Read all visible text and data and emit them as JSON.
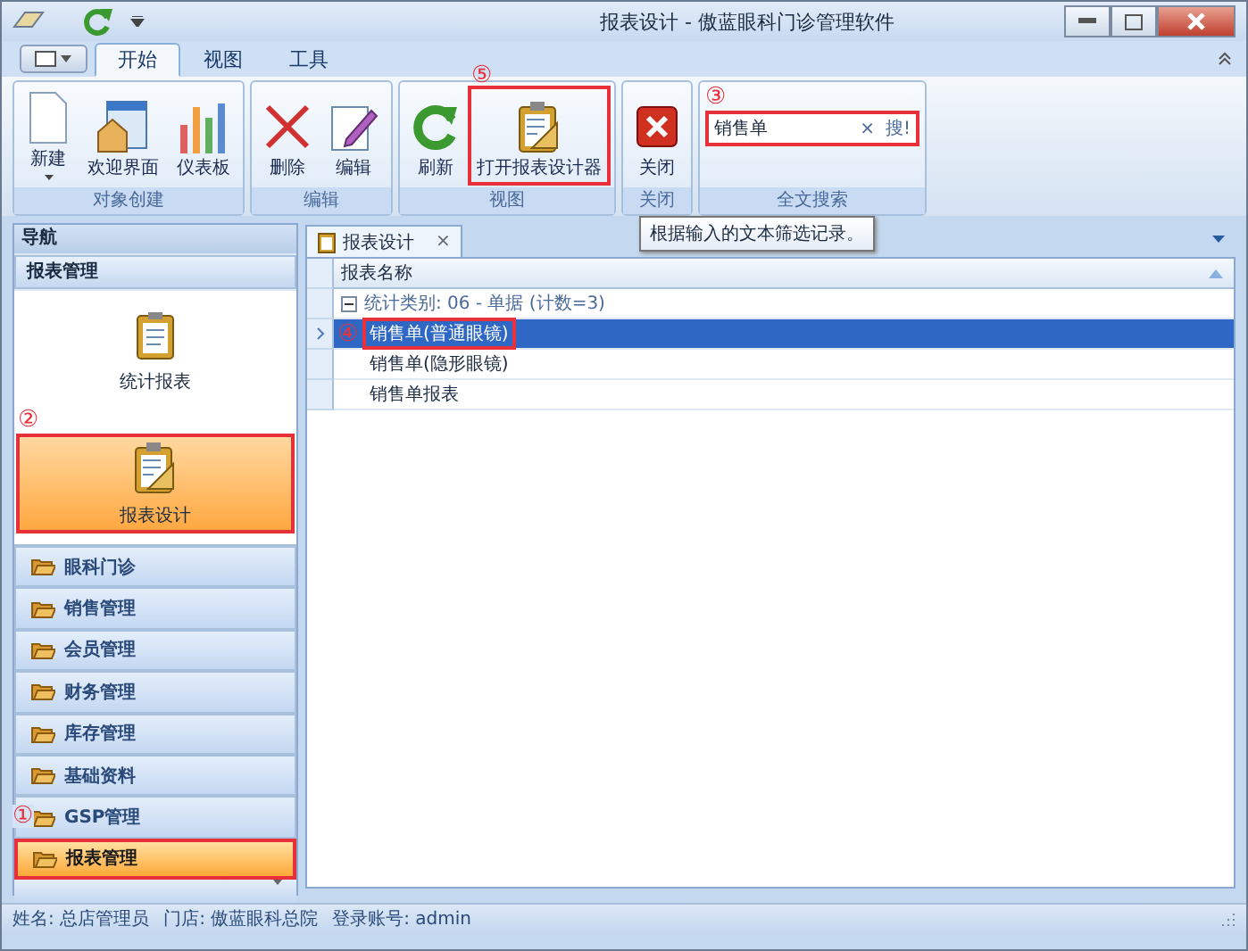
{
  "window": {
    "title": "报表设计 - 傲蓝眼科门诊管理软件"
  },
  "ribbon": {
    "tabs": [
      {
        "label": "开始",
        "selected": true
      },
      {
        "label": "视图",
        "selected": false
      },
      {
        "label": "工具",
        "selected": false
      }
    ],
    "groups": [
      {
        "label": "对象创建",
        "buttons": [
          {
            "label": "新建",
            "dropdown": true,
            "highlighted": false
          },
          {
            "label": "欢迎界面",
            "dropdown": false,
            "highlighted": false
          },
          {
            "label": "仪表板",
            "dropdown": false,
            "highlighted": false
          }
        ]
      },
      {
        "label": "编辑",
        "buttons": [
          {
            "label": "删除",
            "dropdown": false,
            "highlighted": false
          },
          {
            "label": "编辑",
            "dropdown": false,
            "highlighted": false
          }
        ]
      },
      {
        "label": "视图",
        "buttons": [
          {
            "label": "刷新",
            "dropdown": false,
            "highlighted": false
          },
          {
            "label": "打开报表设计器",
            "dropdown": false,
            "highlighted": true,
            "callout": "⑤"
          }
        ]
      },
      {
        "label": "关闭",
        "buttons": [
          {
            "label": "关闭",
            "dropdown": false,
            "highlighted": false
          }
        ]
      }
    ],
    "search": {
      "label": "全文搜索",
      "value": "销售单",
      "clear": "×",
      "go": "搜!",
      "highlighted": true,
      "callout": "③"
    },
    "tooltip": "根据输入的文本筛选记录。"
  },
  "nav": {
    "title": "导航",
    "section": "报表管理",
    "items": [
      {
        "label": "统计报表",
        "selected": false,
        "highlighted": false
      },
      {
        "label": "报表设计",
        "selected": true,
        "highlighted": true,
        "callout": "②"
      }
    ],
    "groups": [
      {
        "label": "眼科门诊",
        "selected": false,
        "highlighted": false
      },
      {
        "label": "销售管理",
        "selected": false,
        "highlighted": false
      },
      {
        "label": "会员管理",
        "selected": false,
        "highlighted": false
      },
      {
        "label": "财务管理",
        "selected": false,
        "highlighted": false
      },
      {
        "label": "库存管理",
        "selected": false,
        "highlighted": false
      },
      {
        "label": "基础资料",
        "selected": false,
        "highlighted": false
      },
      {
        "label": "GSP管理",
        "selected": false,
        "highlighted": false,
        "callout": "①"
      },
      {
        "label": "报表管理",
        "selected": true,
        "highlighted": true
      }
    ]
  },
  "document": {
    "tab": {
      "label": "报表设计",
      "close": "×"
    },
    "grid": {
      "column": "报表名称",
      "group": {
        "label": "统计类别: 06 - 单据 (计数=3)",
        "expanded": true
      },
      "rows": [
        {
          "name": "销售单(普通眼镜)",
          "selected": true,
          "highlighted": true,
          "callout": "④"
        },
        {
          "name": "销售单(隐形眼镜)",
          "selected": false,
          "highlighted": false
        },
        {
          "name": "销售单报表",
          "selected": false,
          "highlighted": false
        }
      ]
    }
  },
  "status_bar": [
    "姓名: 总店管理员",
    "门店: 傲蓝眼科总院",
    "登录账号: admin"
  ]
}
